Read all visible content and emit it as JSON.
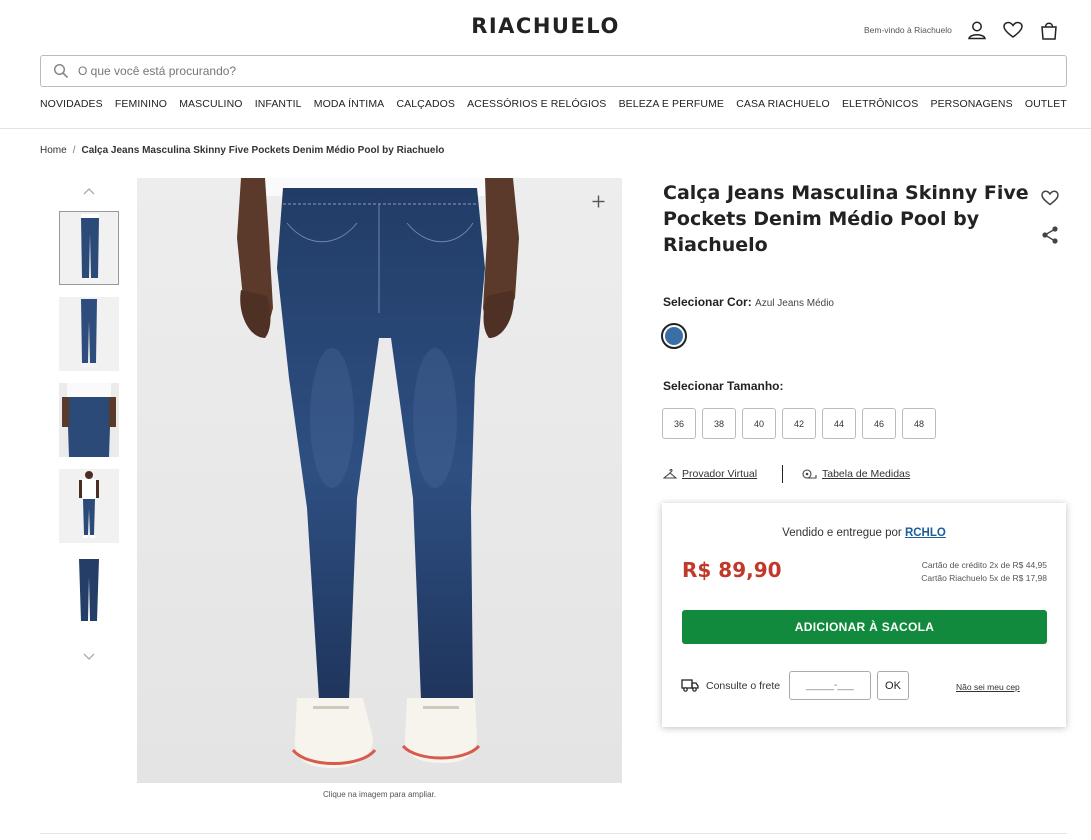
{
  "header": {
    "logo": "RIACHUELO",
    "welcome": "Bem-vindo à Riachuelo",
    "icons": [
      "user-icon",
      "heart-icon",
      "bag-icon"
    ]
  },
  "search": {
    "placeholder": "O que você está procurando?"
  },
  "nav": [
    "NOVIDADES",
    "FEMININO",
    "MASCULINO",
    "INFANTIL",
    "MODA ÍNTIMA",
    "CALÇADOS",
    "ACESSÓRIOS E RELÓGIOS",
    "BELEZA E PERFUME",
    "CASA RIACHUELO",
    "ELETRÔNICOS",
    "PERSONAGENS",
    "OUTLET"
  ],
  "breadcrumb": {
    "home": "Home",
    "separator": "/",
    "current": "Calça Jeans Masculina Skinny Five Pockets Denim Médio Pool by Riachuelo"
  },
  "gallery": {
    "hint": "Clique na imagem para ampliar.",
    "thumbnail_count": 5,
    "selected_thumbnail": 1
  },
  "product": {
    "title": "Calça Jeans Masculina Skinny Five Pockets Denim Médio Pool by Riachuelo",
    "color_label": "Selecionar Cor:",
    "color_value": "Azul Jeans Médio",
    "color_hex": "#3a6fa5",
    "size_label": "Selecionar Tamanho:",
    "sizes": [
      "36",
      "38",
      "40",
      "42",
      "44",
      "46",
      "48"
    ],
    "virtual_fitter": "Provador Virtual",
    "size_chart": "Tabela de Medidas"
  },
  "buybox": {
    "sold_by_text": "Vendido e entregue por",
    "seller": "RCHLO",
    "price": "R$ 89,90",
    "installment_credit": "Cartão de crédito 2x de R$ 44,95",
    "installment_store": "Cartão Riachuelo 5x de R$ 17,98",
    "add_button": "ADICIONAR À SACOLA",
    "shipping_label": "Consulte o frete",
    "cep_placeholder": "_____-___",
    "ok_button": "OK",
    "no_cep_link": "Não sei meu cep"
  },
  "colors": {
    "price_red": "#c0392b",
    "add_green": "#128a3d",
    "link_blue": "#1a5e9a"
  }
}
